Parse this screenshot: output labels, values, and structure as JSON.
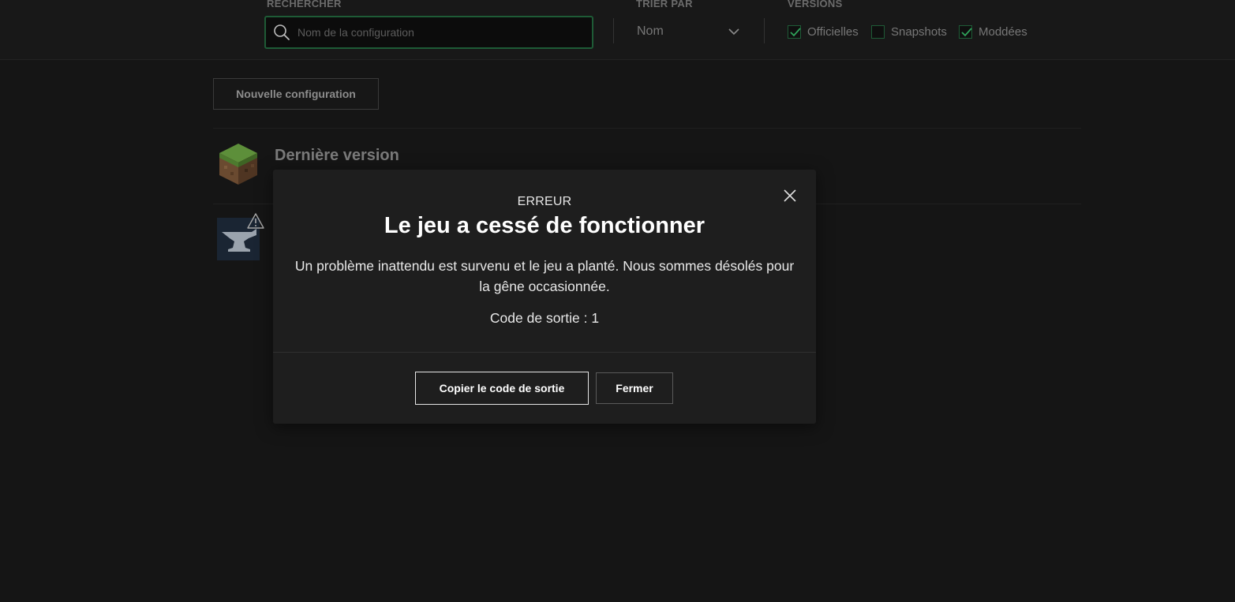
{
  "filters": {
    "search": {
      "label": "RECHERCHER",
      "placeholder": "Nom de la configuration",
      "value": ""
    },
    "sort": {
      "label": "TRIER PAR",
      "selected": "Nom"
    },
    "versions": {
      "label": "VERSIONS",
      "items": [
        {
          "label": "Officielles",
          "checked": true
        },
        {
          "label": "Snapshots",
          "checked": false
        },
        {
          "label": "Moddées",
          "checked": true
        }
      ]
    }
  },
  "main": {
    "new_config_label": "Nouvelle configuration",
    "installations": [
      {
        "name": "Dernière version",
        "icon": "grass-block-icon"
      },
      {
        "name": "",
        "icon": "forge-anvil-icon",
        "warning": true
      }
    ]
  },
  "modal": {
    "kicker": "ERREUR",
    "title": "Le jeu a cessé de fonctionner",
    "message": "Un problème inattendu est survenu et le jeu a planté. Nous sommes désolés pour la gêne occasionnée.",
    "exit_code": "Code de sortie : 1",
    "copy_button": "Copier le code de sortie",
    "close_button": "Fermer"
  },
  "colors": {
    "accent": "#1e5b36",
    "check": "#2fa35a",
    "background": "#151515",
    "modal": "#1e1e1e"
  }
}
